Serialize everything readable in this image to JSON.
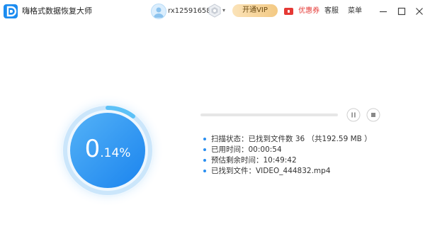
{
  "app": {
    "title": "嗨格式数据恢复大师",
    "logo_icon": "app-logo-d-icon",
    "brand_color": "#1c8cf0"
  },
  "header": {
    "username": "rx12591658",
    "avatar_icon": "user-avatar-icon",
    "vip_badge_icon": "vip-badge-icon",
    "dropdown_glyph": "▾",
    "vip_button_label": "开通VIP",
    "coupon_label": "优惠券",
    "coupon_color": "#e53935",
    "service_label": "客服",
    "menu_label": "菜单",
    "window_controls": [
      "minimize-icon",
      "maximize-icon",
      "close-icon"
    ]
  },
  "progress": {
    "percent_int": "0",
    "percent_frac": ".14%",
    "value": 0.0014,
    "accent": "#2a8ff0"
  },
  "scan_bar": {
    "fill_fraction": 0.0
  },
  "controls": {
    "pause_icon": "pause-icon",
    "stop_icon": "stop-icon"
  },
  "info": [
    {
      "label": "扫描状态：",
      "value": "已找到文件数 36 （共192.59 MB ）"
    },
    {
      "label": "已用时间：",
      "value": "00:00:54"
    },
    {
      "label": "预估剩余时间：",
      "value": "10:49:42"
    },
    {
      "label": "已找到文件：",
      "value": "VIDEO_444832.mp4"
    }
  ]
}
